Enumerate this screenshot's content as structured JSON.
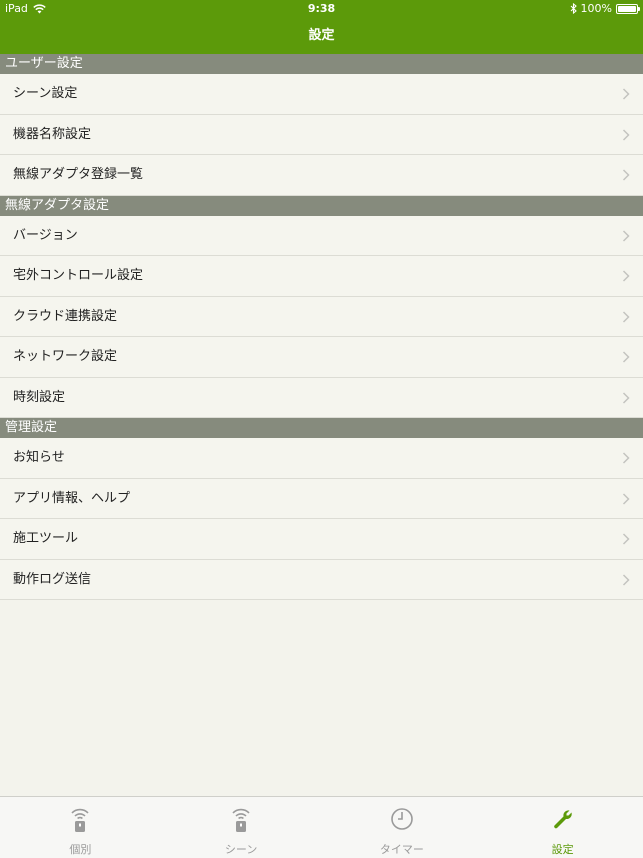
{
  "status_bar": {
    "device": "iPad",
    "time": "9:38",
    "battery_text": "100%",
    "battery_level": 1.0
  },
  "nav": {
    "title": "設定"
  },
  "sections": [
    {
      "header": "ユーザー設定",
      "items": [
        {
          "label": "シーン設定"
        },
        {
          "label": "機器名称設定"
        },
        {
          "label": "無線アダプタ登録一覧"
        }
      ]
    },
    {
      "header": "無線アダプタ設定",
      "items": [
        {
          "label": "バージョン"
        },
        {
          "label": "宅外コントロール設定"
        },
        {
          "label": "クラウド連携設定"
        },
        {
          "label": "ネットワーク設定"
        },
        {
          "label": "時刻設定"
        }
      ]
    },
    {
      "header": "管理設定",
      "items": [
        {
          "label": "お知らせ"
        },
        {
          "label": "アプリ情報、ヘルプ"
        },
        {
          "label": "施工ツール"
        },
        {
          "label": "動作ログ送信"
        }
      ]
    }
  ],
  "tabs": [
    {
      "label": "個別",
      "icon": "wireless-adapter-icon",
      "active": false
    },
    {
      "label": "シーン",
      "icon": "wireless-adapter-icon",
      "active": false
    },
    {
      "label": "タイマー",
      "icon": "clock-icon",
      "active": false
    },
    {
      "label": "設定",
      "icon": "wrench-icon",
      "active": true
    }
  ],
  "colors": {
    "accent": "#5c9a0a",
    "section_header": "#868b7d",
    "background": "#f3f3ec",
    "inactive_tab": "#9a9a9a"
  }
}
